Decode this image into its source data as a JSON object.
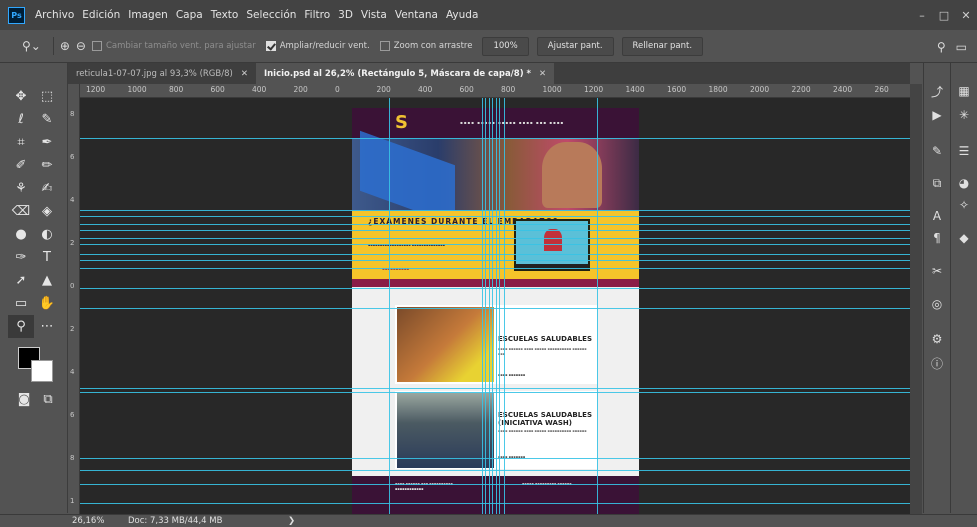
{
  "app": {
    "logo": "Ps"
  },
  "menu": [
    "Archivo",
    "Edición",
    "Imagen",
    "Capa",
    "Texto",
    "Selección",
    "Filtro",
    "3D",
    "Vista",
    "Ventana",
    "Ayuda"
  ],
  "window_controls": {
    "minimize": "–",
    "maximize": "□",
    "close": "✕"
  },
  "options": {
    "resize_window": "Cambiar tamaño vent. para ajustar",
    "zoom_window": "Ampliar/reducir vent.",
    "scrubby_zoom": "Zoom con arrastre",
    "percent_btn": "100%",
    "fit_btn": "Ajustar pant.",
    "fill_btn": "Rellenar pant."
  },
  "tabs": [
    {
      "label": "reticula1-07-07.jpg al 93,3% (RGB/8)",
      "close": "✕"
    },
    {
      "label": "Inicio.psd al 26,2% (Rectángulo 5, Máscara de capa/8) *",
      "close": "✕"
    }
  ],
  "ruler": {
    "top": [
      "1200",
      "1000",
      "800",
      "600",
      "400",
      "200",
      "0",
      "200",
      "400",
      "600",
      "800",
      "1000",
      "1200",
      "1400",
      "1600",
      "1800",
      "2000",
      "2200",
      "2400",
      "260"
    ],
    "left": [
      "8",
      "6",
      "4",
      "2",
      "0",
      "2",
      "4",
      "6",
      "8",
      "1"
    ]
  },
  "document": {
    "banner_title": "¿EXÁMENES DURANTE EL EMBARAZO?",
    "card1_title": "ESCUELAS SALUDABLES",
    "card2_title": "ESCUELAS SALUDABLES (INICIATIVA WASH)"
  },
  "status": {
    "zoom": "26,16%",
    "doc": "Doc: 7,33 MB/44,4 MB",
    "arrow": "❯"
  },
  "colors": {
    "accent_guide": "#37c3e6",
    "header_purple": "#3a1236",
    "banner_yellow": "#f5c42a"
  }
}
